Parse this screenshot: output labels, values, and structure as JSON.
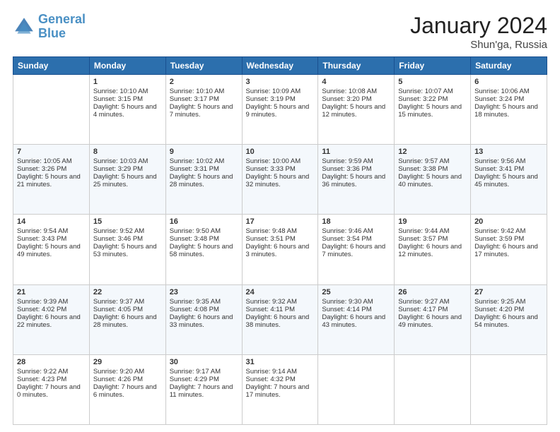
{
  "header": {
    "logo_line1": "General",
    "logo_line2": "Blue",
    "month_year": "January 2024",
    "location": "Shun'ga, Russia"
  },
  "days_of_week": [
    "Sunday",
    "Monday",
    "Tuesday",
    "Wednesday",
    "Thursday",
    "Friday",
    "Saturday"
  ],
  "weeks": [
    [
      {
        "day": "",
        "empty": true
      },
      {
        "day": "1",
        "sunrise": "Sunrise: 10:10 AM",
        "sunset": "Sunset: 3:15 PM",
        "daylight": "Daylight: 5 hours and 4 minutes."
      },
      {
        "day": "2",
        "sunrise": "Sunrise: 10:10 AM",
        "sunset": "Sunset: 3:17 PM",
        "daylight": "Daylight: 5 hours and 7 minutes."
      },
      {
        "day": "3",
        "sunrise": "Sunrise: 10:09 AM",
        "sunset": "Sunset: 3:19 PM",
        "daylight": "Daylight: 5 hours and 9 minutes."
      },
      {
        "day": "4",
        "sunrise": "Sunrise: 10:08 AM",
        "sunset": "Sunset: 3:20 PM",
        "daylight": "Daylight: 5 hours and 12 minutes."
      },
      {
        "day": "5",
        "sunrise": "Sunrise: 10:07 AM",
        "sunset": "Sunset: 3:22 PM",
        "daylight": "Daylight: 5 hours and 15 minutes."
      },
      {
        "day": "6",
        "sunrise": "Sunrise: 10:06 AM",
        "sunset": "Sunset: 3:24 PM",
        "daylight": "Daylight: 5 hours and 18 minutes."
      }
    ],
    [
      {
        "day": "7",
        "sunrise": "Sunrise: 10:05 AM",
        "sunset": "Sunset: 3:26 PM",
        "daylight": "Daylight: 5 hours and 21 minutes."
      },
      {
        "day": "8",
        "sunrise": "Sunrise: 10:03 AM",
        "sunset": "Sunset: 3:29 PM",
        "daylight": "Daylight: 5 hours and 25 minutes."
      },
      {
        "day": "9",
        "sunrise": "Sunrise: 10:02 AM",
        "sunset": "Sunset: 3:31 PM",
        "daylight": "Daylight: 5 hours and 28 minutes."
      },
      {
        "day": "10",
        "sunrise": "Sunrise: 10:00 AM",
        "sunset": "Sunset: 3:33 PM",
        "daylight": "Daylight: 5 hours and 32 minutes."
      },
      {
        "day": "11",
        "sunrise": "Sunrise: 9:59 AM",
        "sunset": "Sunset: 3:36 PM",
        "daylight": "Daylight: 5 hours and 36 minutes."
      },
      {
        "day": "12",
        "sunrise": "Sunrise: 9:57 AM",
        "sunset": "Sunset: 3:38 PM",
        "daylight": "Daylight: 5 hours and 40 minutes."
      },
      {
        "day": "13",
        "sunrise": "Sunrise: 9:56 AM",
        "sunset": "Sunset: 3:41 PM",
        "daylight": "Daylight: 5 hours and 45 minutes."
      }
    ],
    [
      {
        "day": "14",
        "sunrise": "Sunrise: 9:54 AM",
        "sunset": "Sunset: 3:43 PM",
        "daylight": "Daylight: 5 hours and 49 minutes."
      },
      {
        "day": "15",
        "sunrise": "Sunrise: 9:52 AM",
        "sunset": "Sunset: 3:46 PM",
        "daylight": "Daylight: 5 hours and 53 minutes."
      },
      {
        "day": "16",
        "sunrise": "Sunrise: 9:50 AM",
        "sunset": "Sunset: 3:48 PM",
        "daylight": "Daylight: 5 hours and 58 minutes."
      },
      {
        "day": "17",
        "sunrise": "Sunrise: 9:48 AM",
        "sunset": "Sunset: 3:51 PM",
        "daylight": "Daylight: 6 hours and 3 minutes."
      },
      {
        "day": "18",
        "sunrise": "Sunrise: 9:46 AM",
        "sunset": "Sunset: 3:54 PM",
        "daylight": "Daylight: 6 hours and 7 minutes."
      },
      {
        "day": "19",
        "sunrise": "Sunrise: 9:44 AM",
        "sunset": "Sunset: 3:57 PM",
        "daylight": "Daylight: 6 hours and 12 minutes."
      },
      {
        "day": "20",
        "sunrise": "Sunrise: 9:42 AM",
        "sunset": "Sunset: 3:59 PM",
        "daylight": "Daylight: 6 hours and 17 minutes."
      }
    ],
    [
      {
        "day": "21",
        "sunrise": "Sunrise: 9:39 AM",
        "sunset": "Sunset: 4:02 PM",
        "daylight": "Daylight: 6 hours and 22 minutes."
      },
      {
        "day": "22",
        "sunrise": "Sunrise: 9:37 AM",
        "sunset": "Sunset: 4:05 PM",
        "daylight": "Daylight: 6 hours and 28 minutes."
      },
      {
        "day": "23",
        "sunrise": "Sunrise: 9:35 AM",
        "sunset": "Sunset: 4:08 PM",
        "daylight": "Daylight: 6 hours and 33 minutes."
      },
      {
        "day": "24",
        "sunrise": "Sunrise: 9:32 AM",
        "sunset": "Sunset: 4:11 PM",
        "daylight": "Daylight: 6 hours and 38 minutes."
      },
      {
        "day": "25",
        "sunrise": "Sunrise: 9:30 AM",
        "sunset": "Sunset: 4:14 PM",
        "daylight": "Daylight: 6 hours and 43 minutes."
      },
      {
        "day": "26",
        "sunrise": "Sunrise: 9:27 AM",
        "sunset": "Sunset: 4:17 PM",
        "daylight": "Daylight: 6 hours and 49 minutes."
      },
      {
        "day": "27",
        "sunrise": "Sunrise: 9:25 AM",
        "sunset": "Sunset: 4:20 PM",
        "daylight": "Daylight: 6 hours and 54 minutes."
      }
    ],
    [
      {
        "day": "28",
        "sunrise": "Sunrise: 9:22 AM",
        "sunset": "Sunset: 4:23 PM",
        "daylight": "Daylight: 7 hours and 0 minutes."
      },
      {
        "day": "29",
        "sunrise": "Sunrise: 9:20 AM",
        "sunset": "Sunset: 4:26 PM",
        "daylight": "Daylight: 7 hours and 6 minutes."
      },
      {
        "day": "30",
        "sunrise": "Sunrise: 9:17 AM",
        "sunset": "Sunset: 4:29 PM",
        "daylight": "Daylight: 7 hours and 11 minutes."
      },
      {
        "day": "31",
        "sunrise": "Sunrise: 9:14 AM",
        "sunset": "Sunset: 4:32 PM",
        "daylight": "Daylight: 7 hours and 17 minutes."
      },
      {
        "day": "",
        "empty": true
      },
      {
        "day": "",
        "empty": true
      },
      {
        "day": "",
        "empty": true
      }
    ]
  ]
}
